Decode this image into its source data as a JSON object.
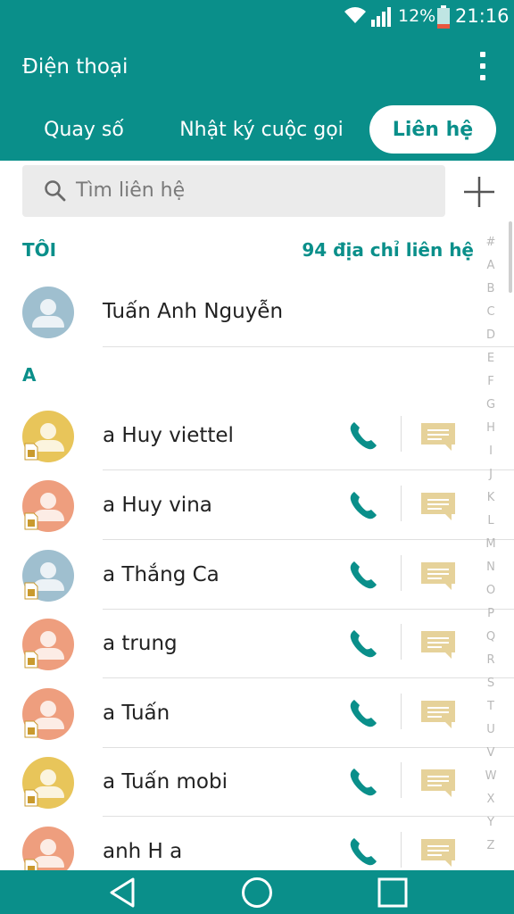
{
  "status_bar": {
    "battery_percent": "12%",
    "time": "21:16",
    "icons": [
      "wifi-icon",
      "signal-icon",
      "battery-icon"
    ]
  },
  "app_bar": {
    "title": "Điện thoại",
    "tabs": [
      {
        "label": "Quay số",
        "active": false
      },
      {
        "label": "Nhật ký cuộc gọi",
        "active": false
      },
      {
        "label": "Liên hệ",
        "active": true
      }
    ]
  },
  "search": {
    "placeholder": "Tìm liên hệ"
  },
  "me_section": {
    "header": "TÔI",
    "count_label": "94 địa chỉ liên hệ",
    "name": "Tuấn Anh Nguyễn"
  },
  "section_letter": "A",
  "contacts": [
    {
      "name": "a Huy viettel",
      "avatar_color": "#e8c55a"
    },
    {
      "name": "a Huy vina",
      "avatar_color": "#ee9e7e"
    },
    {
      "name": "a Thắng Ca",
      "avatar_color": "#9fbfcf"
    },
    {
      "name": "a trung",
      "avatar_color": "#ee9e7e"
    },
    {
      "name": "a Tuấn",
      "avatar_color": "#ee9e7e"
    },
    {
      "name": "a Tuấn mobi",
      "avatar_color": "#e8c55a"
    },
    {
      "name": "anh H a",
      "avatar_color": "#ee9e7e"
    }
  ],
  "index_letters": [
    "#",
    "A",
    "B",
    "C",
    "D",
    "E",
    "F",
    "G",
    "H",
    "I",
    "J",
    "K",
    "L",
    "M",
    "N",
    "O",
    "P",
    "Q",
    "R",
    "S",
    "T",
    "U",
    "V",
    "W",
    "X",
    "Y",
    "Z"
  ],
  "colors": {
    "primary": "#0a8f8a",
    "message_icon": "#e6d29a",
    "battery_low": "#e8573f"
  }
}
